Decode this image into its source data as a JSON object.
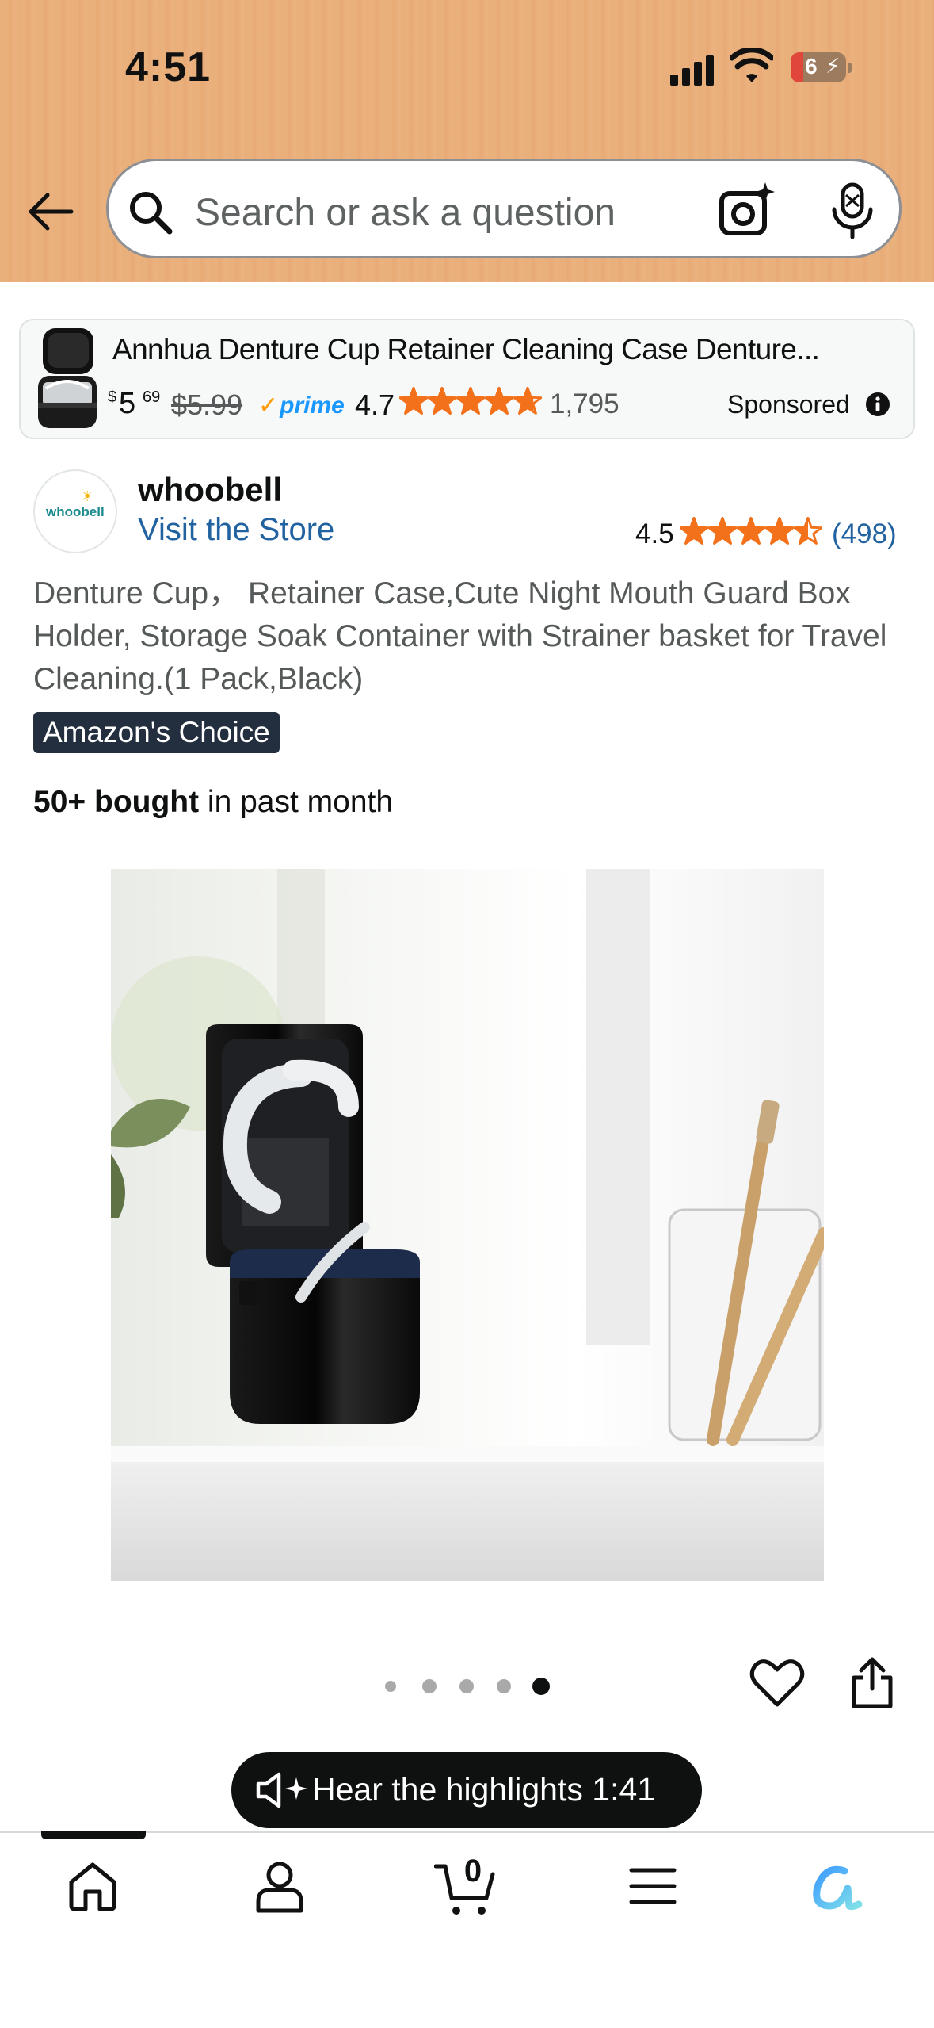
{
  "status_bar": {
    "time": "4:51",
    "battery": "6"
  },
  "search": {
    "placeholder": "Search or ask a question"
  },
  "sponsored_card": {
    "title": "Annhua Denture Cup Retainer Cleaning Case Denture...",
    "price_symbol": "$",
    "price_whole": "5",
    "price_fraction": "69",
    "list_price": "$5.99",
    "prime_label": "prime",
    "rating": "4.7",
    "rating_value": 4.7,
    "review_count": "1,795",
    "sponsored_label": "Sponsored"
  },
  "brand": {
    "logo_text": "whoobell",
    "name": "whoobell",
    "visit_store": "Visit the Store",
    "rating": "4.5",
    "rating_value": 4.5,
    "review_count": "(498)"
  },
  "product": {
    "title": "Denture Cup， Retainer Case,Cute Night Mouth Guard Box Holder, Storage Soak Container with Strainer basket for Travel Cleaning.(1 Pack,Black)",
    "badge": "Amazon's Choice",
    "bought_bold": "50+ bought",
    "bought_rest": " in past month"
  },
  "carousel": {
    "total": 5,
    "active": 5
  },
  "highlights": {
    "label": "Hear the highlights 1:41"
  },
  "bottom_nav": {
    "items": [
      "home-icon",
      "account-icon",
      "cart-icon",
      "menu-icon",
      "rufus-icon"
    ],
    "cart_count": "0"
  },
  "colors": {
    "header": "#eab07c",
    "link": "#2162a1",
    "star": "#f3711a",
    "badge": "#232f3e",
    "prime": "#1a98ff"
  }
}
